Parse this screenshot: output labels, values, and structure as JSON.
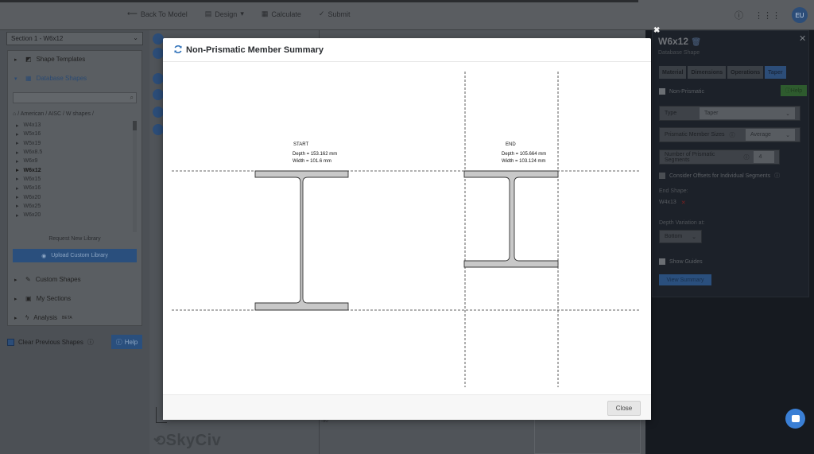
{
  "topbar": {
    "back_label": "Back To Model",
    "design_label": "Design",
    "calculate_label": "Calculate",
    "submit_label": "Submit",
    "user_initials": "EU"
  },
  "left": {
    "section_select": "Section 1 - W6x12",
    "accordion": {
      "shape_templates": "Shape Templates",
      "database_shapes": "Database Shapes",
      "custom_shapes": "Custom Shapes",
      "my_sections": "My Sections",
      "analysis": "Analysis",
      "analysis_badge": "BETA"
    },
    "breadcrumb": "/ American / AISC / W shapes /",
    "shapes": [
      "W4x13",
      "W5x16",
      "W5x19",
      "W6x8.5",
      "W6x9",
      "W6x12",
      "W6x15",
      "W6x16",
      "W6x20",
      "W6x25",
      "W6x20"
    ],
    "selected_shape": "W6x12",
    "request_library": "Request New Library",
    "upload_library": "Upload Custom Library",
    "clear_previous": "Clear Previous Shapes",
    "help": "Help"
  },
  "canvas": {
    "logo": "SkyCiv",
    "axis_tick": "-50"
  },
  "right": {
    "title": "W6x12",
    "subtitle": "Database Shape",
    "tabs": [
      "Material",
      "Dimensions",
      "Operations",
      "Taper"
    ],
    "non_prismatic": "Non-Prismatic",
    "help": "Help",
    "type_label": "Type",
    "type_value": "Taper",
    "sizes_label": "Prismatic Member Sizes",
    "sizes_value": "Average",
    "segments_label": "Number of Prismatic Segments",
    "segments_value": "4",
    "offsets_label": "Consider Offsets for Individual Segments",
    "end_shape_label": "End Shape:",
    "end_shape_value": "W4x13",
    "depth_variation_label": "Depth Variation at:",
    "depth_variation_value": "Bottom",
    "show_guides": "Show Guides",
    "view_summary": "View Summary"
  },
  "modal": {
    "title": "Non-Prismatic Member Summary",
    "start": {
      "label": "START",
      "depth": "Depth = 153.162 mm",
      "width": "Width = 101.6 mm"
    },
    "end": {
      "label": "END",
      "depth": "Depth = 105.664 mm",
      "width": "Width = 103.124 mm"
    },
    "close_label": "Close"
  },
  "colors": {
    "accent": "#2c4d78",
    "section_fill": "#c8c8c8",
    "section_stroke": "#333333"
  }
}
